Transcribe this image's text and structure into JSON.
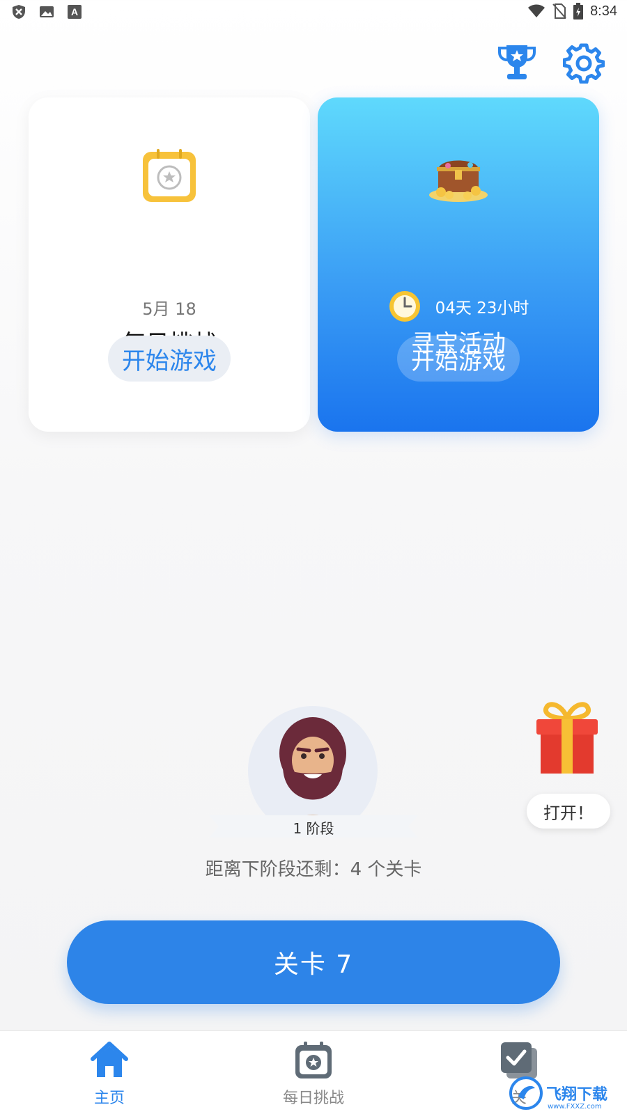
{
  "status_bar": {
    "time": "8:34"
  },
  "daily_card": {
    "title": "每日挑战",
    "date": "5月 18",
    "button": "开始游戏"
  },
  "treasure_card": {
    "title": "寻宝活动",
    "timer": "04天 23小时",
    "button": "开始游戏"
  },
  "stage": {
    "label": "1 阶段",
    "remaining": "距离下阶段还剩：4 个关卡"
  },
  "gift": {
    "button": "打开！"
  },
  "level_button": "关卡 7",
  "bottom_nav": {
    "home": "主页",
    "daily": "每日挑战",
    "levels": "关"
  },
  "watermark": {
    "text": "飞翔下载",
    "sub": "www.FXXZ.com"
  },
  "colors": {
    "accent": "#2c86ec",
    "primary_button": "#2d84e8",
    "treasure_top": "#5fd9fc",
    "treasure_bottom": "#1a74ee"
  },
  "icons": [
    "shield-x-icon",
    "image-icon",
    "font-a-icon",
    "wifi-icon",
    "no-sim-icon",
    "battery-icon",
    "trophy-icon",
    "gear-icon",
    "calendar-star-icon",
    "treasure-chest-icon",
    "clock-icon",
    "gift-icon",
    "home-icon",
    "checkbox-icon"
  ]
}
